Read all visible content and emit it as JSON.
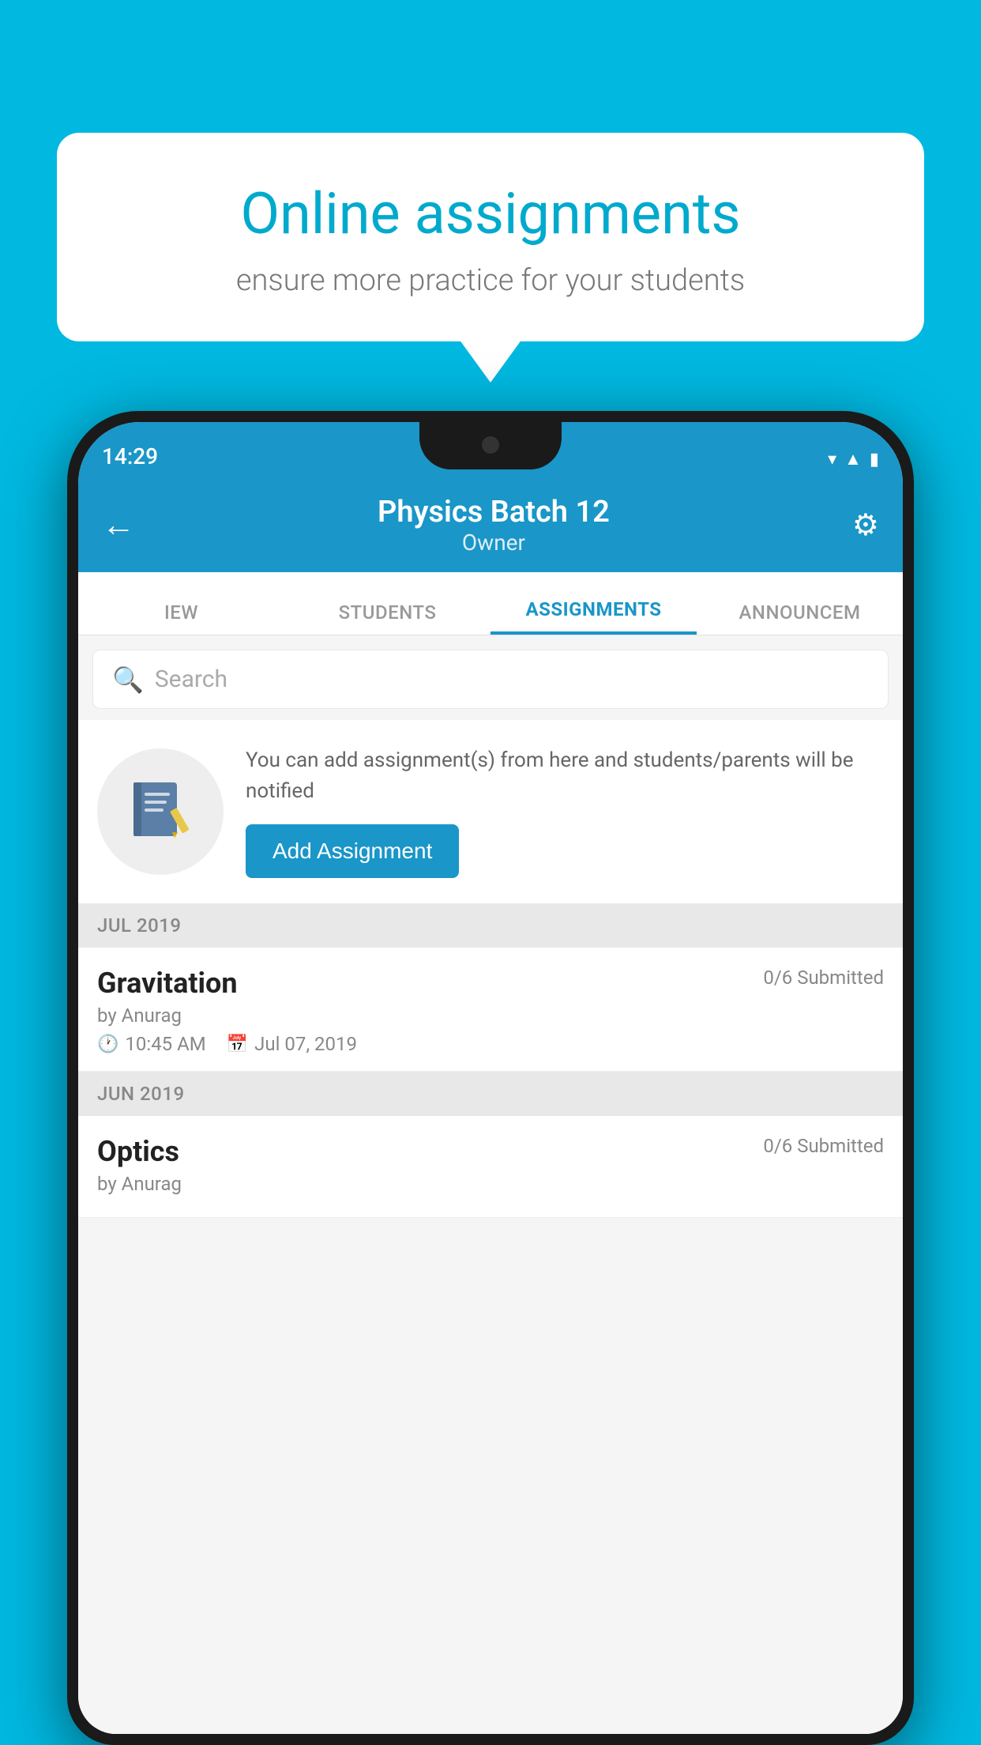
{
  "background_color": "#00b8e0",
  "speech_bubble": {
    "title": "Online assignments",
    "subtitle": "ensure more practice for your students"
  },
  "status_bar": {
    "time": "14:29",
    "icons": [
      "wifi",
      "signal",
      "battery"
    ]
  },
  "header": {
    "title": "Physics Batch 12",
    "subtitle": "Owner",
    "back_label": "←",
    "settings_label": "⚙"
  },
  "tabs": [
    {
      "label": "IEW",
      "active": false
    },
    {
      "label": "STUDENTS",
      "active": false
    },
    {
      "label": "ASSIGNMENTS",
      "active": true
    },
    {
      "label": "ANNOUNCEM",
      "active": false
    }
  ],
  "search": {
    "placeholder": "Search"
  },
  "promo": {
    "description": "You can add assignment(s) from here and students/parents will be notified",
    "button_label": "Add Assignment"
  },
  "sections": [
    {
      "month": "JUL 2019",
      "assignments": [
        {
          "name": "Gravitation",
          "submitted": "0/6 Submitted",
          "by": "by Anurag",
          "time": "10:45 AM",
          "date": "Jul 07, 2019"
        }
      ]
    },
    {
      "month": "JUN 2019",
      "assignments": [
        {
          "name": "Optics",
          "submitted": "0/6 Submitted",
          "by": "by Anurag",
          "time": "",
          "date": ""
        }
      ]
    }
  ]
}
